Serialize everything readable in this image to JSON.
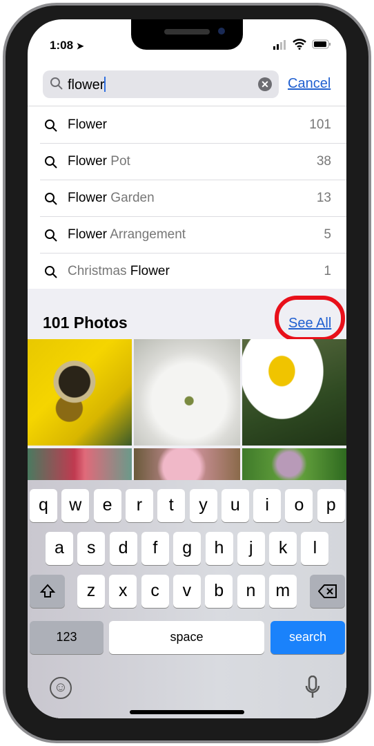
{
  "status": {
    "time": "1:08"
  },
  "search": {
    "value": "flower",
    "cancel": "Cancel"
  },
  "suggestions": [
    {
      "match": "Flower",
      "rest": "",
      "prefix": "",
      "count": "101"
    },
    {
      "match": "Flower",
      "rest": " Pot",
      "prefix": "",
      "count": "38"
    },
    {
      "match": "Flower",
      "rest": " Garden",
      "prefix": "",
      "count": "13"
    },
    {
      "match": "Flower",
      "rest": " Arrangement",
      "prefix": "",
      "count": "5"
    },
    {
      "match": "Flower",
      "rest": "",
      "prefix": "Christmas ",
      "count": "1"
    }
  ],
  "photos": {
    "title": "101 Photos",
    "see_all": "See All",
    "highlight_color": "#e8101a"
  },
  "keyboard": {
    "row1": [
      "q",
      "w",
      "e",
      "r",
      "t",
      "y",
      "u",
      "i",
      "o",
      "p"
    ],
    "row2": [
      "a",
      "s",
      "d",
      "f",
      "g",
      "h",
      "j",
      "k",
      "l"
    ],
    "row3": [
      "z",
      "x",
      "c",
      "v",
      "b",
      "n",
      "m"
    ],
    "numbers": "123",
    "space": "space",
    "search": "search",
    "accent": "#1a82fb"
  }
}
